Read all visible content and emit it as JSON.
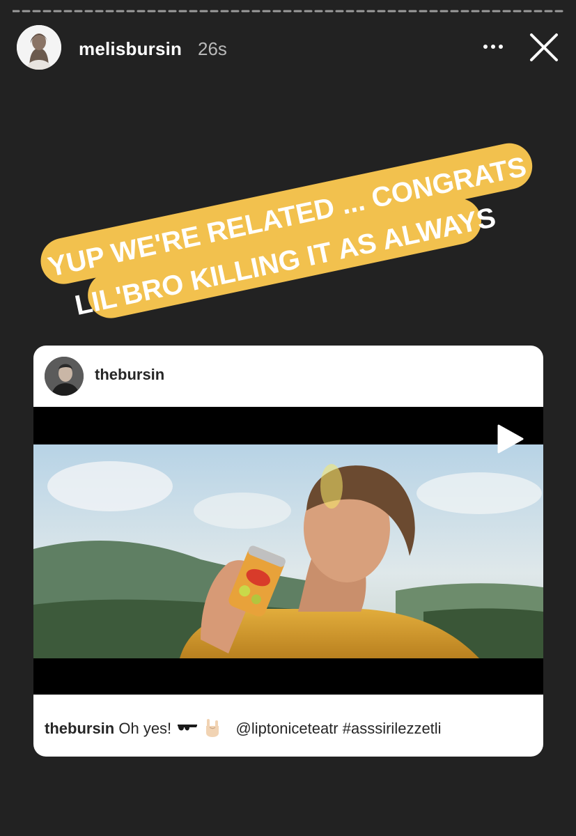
{
  "story": {
    "progress_segments": 1,
    "progress_fraction": 0.02,
    "user": {
      "username": "melisbursin",
      "time_ago": "26s"
    },
    "menu_icon": "more-horizontal-icon",
    "close_icon": "close-icon"
  },
  "sticker": {
    "lines": [
      "YUP WE'RE RELATED ... CONGRATS",
      "LIL'BRO KILLING IT AS ALWAYS"
    ],
    "background_color": "#f2c14e",
    "text_color": "#ffffff"
  },
  "shared_post": {
    "username": "thebursin",
    "play_icon": "play-icon",
    "caption": {
      "username": "thebursin",
      "text": "Oh yes!",
      "emojis": [
        "sunglasses-emoji",
        "rock-on-hand-emoji"
      ],
      "mention": "@liptoniceteatr",
      "hashtag": "#asssirilezzetli"
    }
  },
  "colors": {
    "background": "#222222",
    "card": "#ffffff",
    "text_dark": "#262626",
    "muted": "#b9b9b9"
  }
}
